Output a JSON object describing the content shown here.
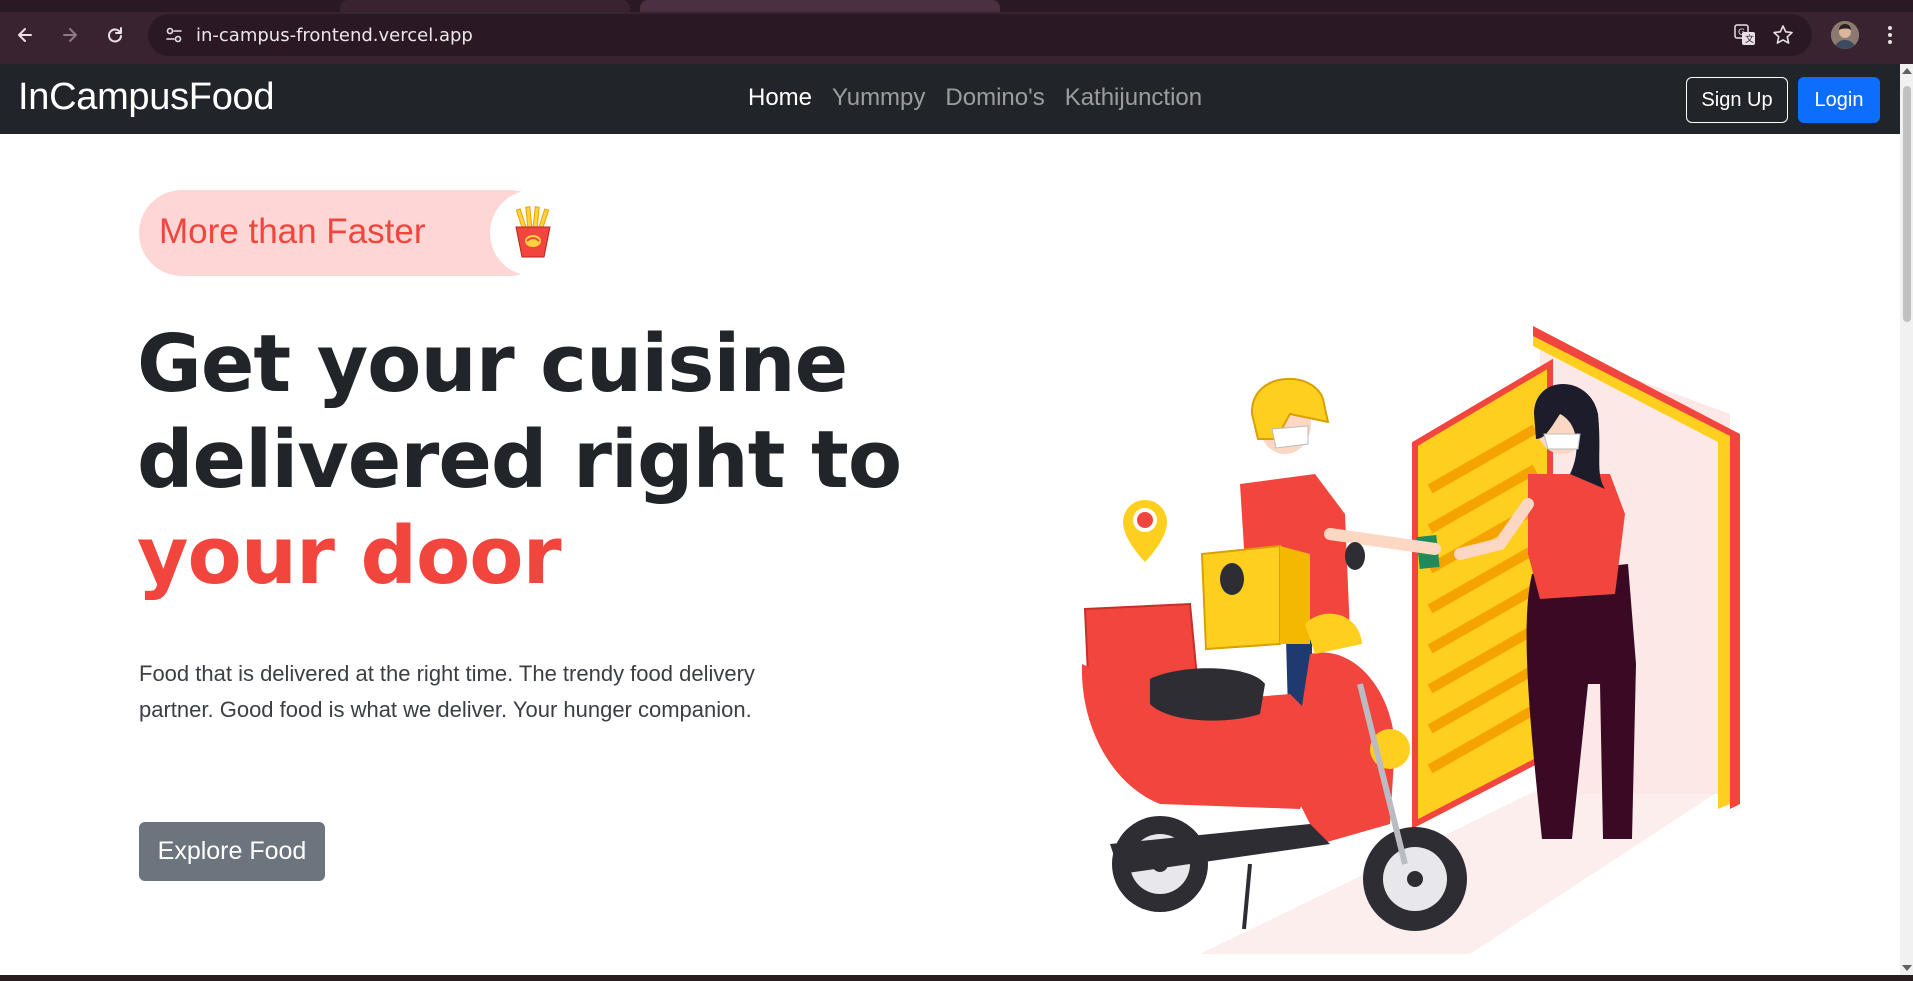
{
  "browser": {
    "url": "in-campus-frontend.vercel.app",
    "icons": [
      "back-arrow-icon",
      "forward-arrow-icon",
      "reload-icon",
      "site-settings-icon",
      "translate-icon",
      "star-icon",
      "profile-avatar",
      "kebab-menu-icon"
    ]
  },
  "navbar": {
    "brand": "InCampusFood",
    "links": [
      {
        "label": "Home",
        "active": true
      },
      {
        "label": "Yummpy",
        "active": false
      },
      {
        "label": "Domino's",
        "active": false
      },
      {
        "label": "Kathijunction",
        "active": false
      }
    ],
    "signup_label": "Sign Up",
    "login_label": "Login"
  },
  "hero": {
    "badge_text": "More than Faster",
    "title_line1": "Get your cuisine",
    "title_line2": "delivered right to",
    "title_line3": "your door",
    "description": "Food that is delivered at the right time. The trendy food delivery partner. Good food is what we deliver. Your hunger companion.",
    "cta_label": "Explore Food"
  },
  "colors": {
    "navbar_bg": "#212529",
    "accent": "#f1453d",
    "badge_bg": "#ffd6d6",
    "login_blue": "#0d6efd",
    "explore_gray": "#6c757d"
  }
}
